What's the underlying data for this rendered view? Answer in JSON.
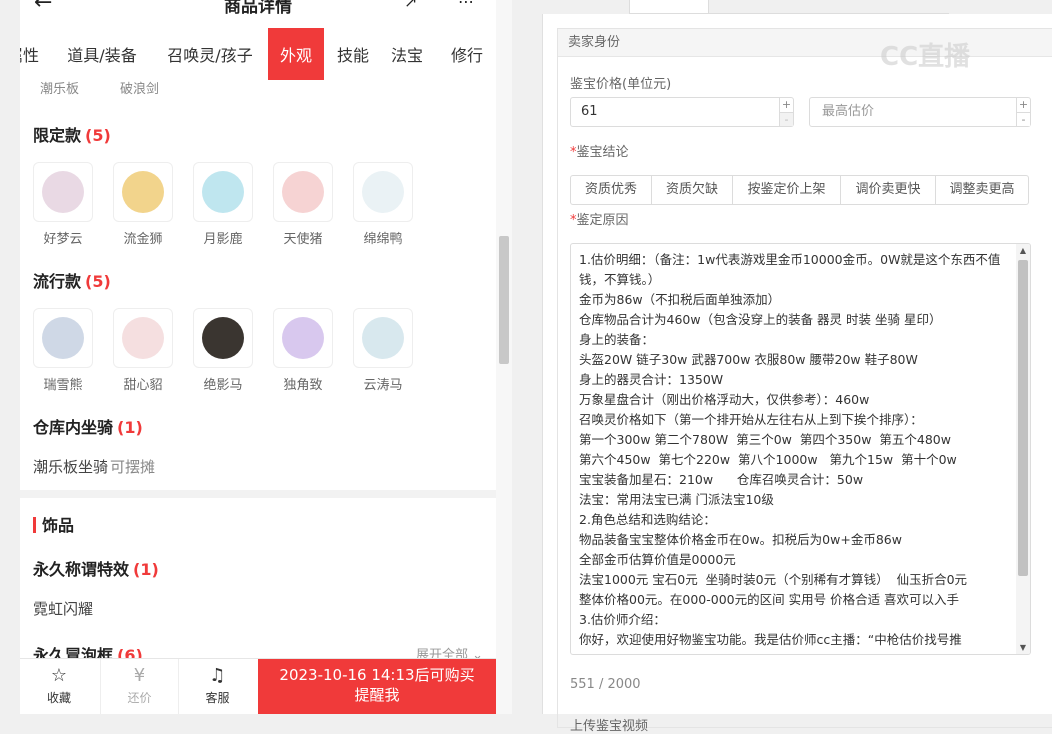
{
  "header": {
    "title": "商品详情"
  },
  "tabs": [
    {
      "label": "属性"
    },
    {
      "label": "道具/装备"
    },
    {
      "label": "召唤灵/孩子"
    },
    {
      "label": "外观",
      "active": true
    },
    {
      "label": "技能"
    },
    {
      "label": "法宝"
    },
    {
      "label": "修行"
    }
  ],
  "prev_items": [
    "潮乐板",
    "破浪剑"
  ],
  "limited": {
    "title": "限定款",
    "count": "(5)",
    "items": [
      {
        "name": "好梦云",
        "color": "#e9d9e4"
      },
      {
        "name": "流金狮",
        "color": "#f2d48c"
      },
      {
        "name": "月影鹿",
        "color": "#bfe6ef"
      },
      {
        "name": "天使猪",
        "color": "#f6d3d3"
      },
      {
        "name": "绵绵鸭",
        "color": "#eaf2f5"
      }
    ]
  },
  "popular": {
    "title": "流行款",
    "count": "(5)",
    "items": [
      {
        "name": "瑞雪熊",
        "color": "#cfd8e6"
      },
      {
        "name": "甜心貂",
        "color": "#f5dfe0"
      },
      {
        "name": "绝影马",
        "color": "#3a3530"
      },
      {
        "name": "独角致",
        "color": "#d8c8ee"
      },
      {
        "name": "云涛马",
        "color": "#d8e8ee"
      }
    ]
  },
  "warehouse": {
    "title": "仓库内坐骑",
    "count": "(1)",
    "item": "潮乐板坐骑",
    "sub": "可摆摊"
  },
  "ornament": {
    "heading": "饰品",
    "title_effect": {
      "title": "永久称谓特效",
      "count": "(1)",
      "item": "霓虹闪耀"
    },
    "bubble": {
      "title": "永久冒泡框",
      "count": "(6)",
      "expand": "展开全部"
    }
  },
  "bottom_bar": {
    "favorite": "收藏",
    "bargain": "还价",
    "service": "客服",
    "buy_line1": "2023-10-16 14:13后可购买",
    "buy_line2": "提醒我"
  },
  "form": {
    "section_title": "卖家身份",
    "price_label": "鉴宝价格(单位元)",
    "price_value": "61",
    "max_placeholder": "最高估价",
    "conclusion_label": "鉴宝结论",
    "conclusions": [
      "资质优秀",
      "资质欠缺",
      "按鉴定价上架",
      "调价卖更快",
      "调整卖更高"
    ],
    "reason_label": "鉴定原因",
    "reason_text": "1.估价明细：（备注：1w代表游戏里金币10000金币。0W就是这个东西不值钱，不算钱。）\n金币为86w（不扣税后面单独添加）\n仓库物品合计为460w（包含没穿上的装备 器灵 时装 坐骑 星印）\n身上的装备：\n头盔20W 链子30w 武器700w 衣服80w 腰带20w 鞋子80W\n身上的器灵合计：1350W\n万象星盘合计（刚出价格浮动大，仅供参考）：460w\n召唤灵价格如下（第一个排开始从左往右从上到下挨个排序）：\n第一个300w 第二个780W  第三个0w  第四个350w  第五个480w\n第六个450w  第七个220w  第八个1000w   第九个15w  第十个0w\n宝宝装备加星石：210w      仓库召唤灵合计：50w\n法宝：常用法宝已满 门派法宝10级\n2.角色总结和选购结论：\n物品装备宝宝整体价格金币在0w。扣税后为0w+金币86w\n全部金币估算价值是0000元\n法宝1000元 宝石0元  坐骑时装0元（个别稀有才算钱）  仙玉折合0元\n整体价格00元。在000-000元的区间 实用号 价格合适 喜欢可以入手\n3.估价师介绍：\n你好，欢迎使用好物鉴宝功能。我是估价师cc主播：“中枪估价找号推",
    "char_count": "551 / 2000",
    "upload_label": "上传鉴宝视频"
  },
  "watermark": "CC直播"
}
